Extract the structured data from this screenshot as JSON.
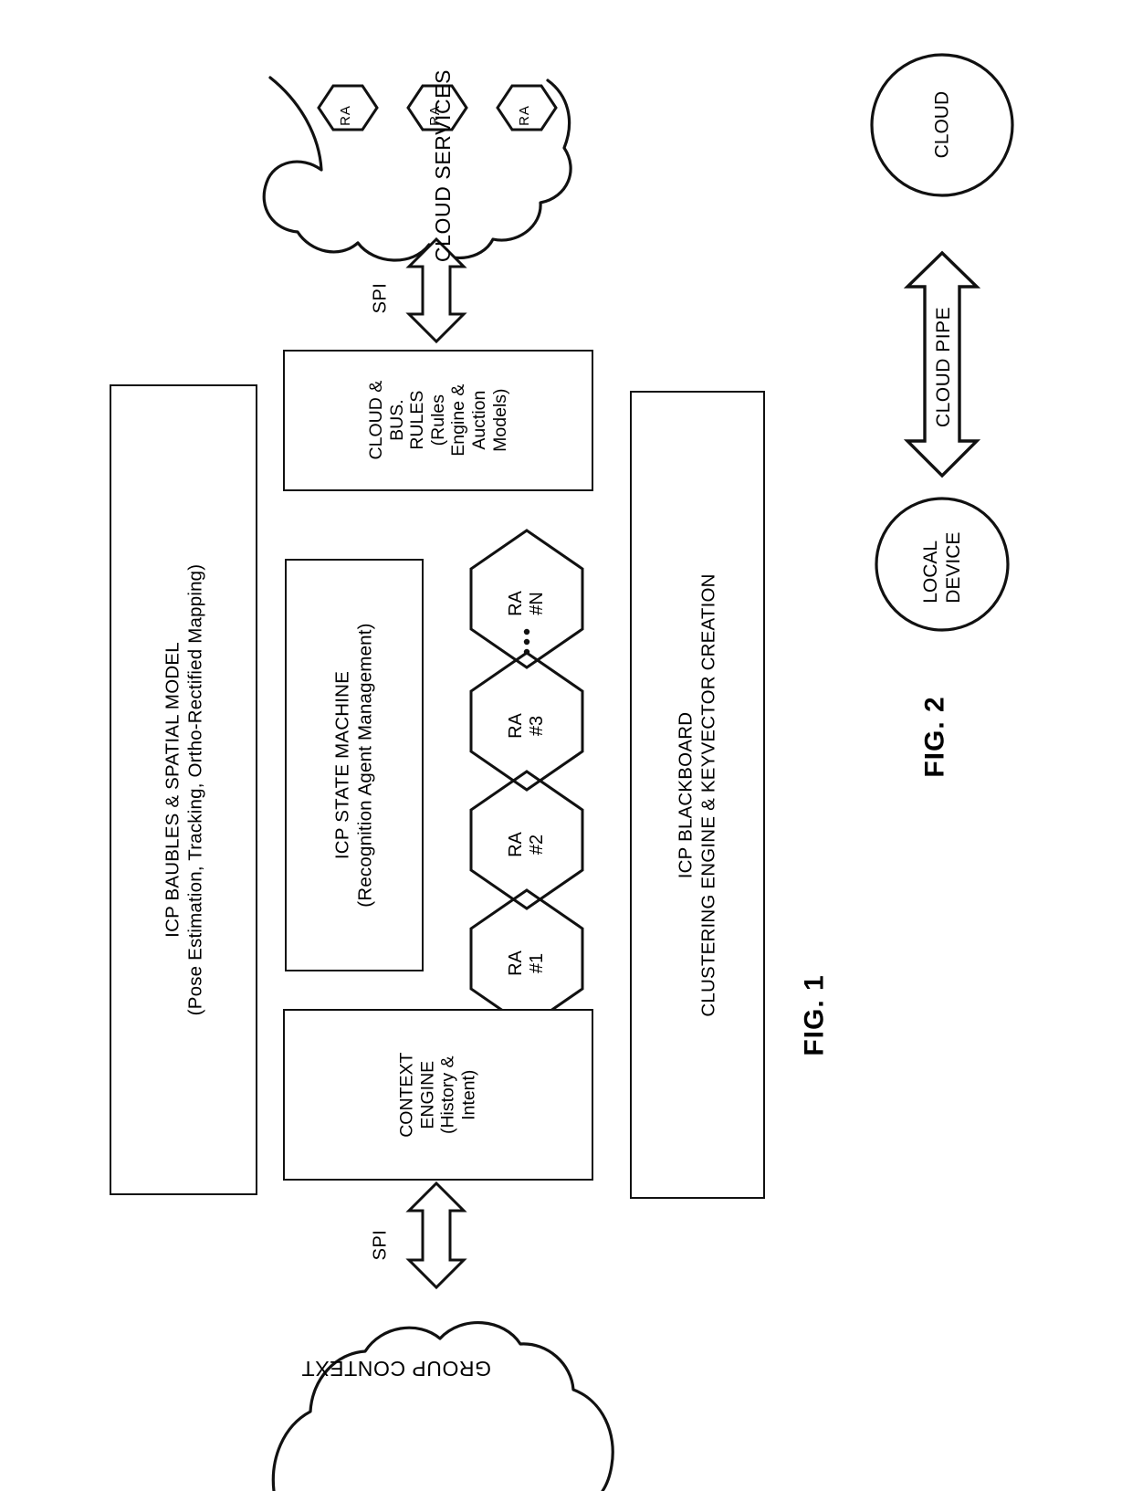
{
  "figures": {
    "fig1": {
      "label": "FIG. 1",
      "cloud_services": {
        "title": "CLOUD SERVICES",
        "agents": [
          "RA",
          "RA",
          "RA"
        ]
      },
      "spi_top": "SPI",
      "spi_bottom": "SPI",
      "group_context": "GROUP CONTEXT",
      "boxes": {
        "baubles": {
          "line1": "ICP BAUBLES & SPATIAL MODEL",
          "line2": "(Pose Estimation, Tracking, Ortho-Rectified Mapping)"
        },
        "cloud_bus_rules": {
          "lines": [
            "CLOUD &",
            "BUS.",
            "RULES",
            "(Rules",
            "Engine &",
            "Auction",
            "Models)"
          ]
        },
        "state_machine": {
          "line1": "ICP STATE MACHINE",
          "line2": "(Recognition Agent Management)"
        },
        "blackboard": {
          "line1": "ICP BLACKBOARD",
          "line2": "CLUSTERING ENGINE & KEYVECTOR CREATION"
        },
        "context_engine": {
          "lines": [
            "CONTEXT",
            "ENGINE",
            "(History &",
            "Intent)"
          ]
        }
      },
      "recognition_agents": [
        {
          "name": "RA",
          "id": "#1"
        },
        {
          "name": "RA",
          "id": "#2"
        },
        {
          "name": "RA",
          "id": "#3"
        },
        {
          "name": "RA",
          "id": "#N"
        }
      ],
      "ellipsis": "⋮"
    },
    "fig2": {
      "label": "FIG. 2",
      "cloud": "CLOUD",
      "pipe": "CLOUD PIPE",
      "local_device": {
        "line1": "LOCAL",
        "line2": "DEVICE"
      }
    }
  },
  "colors": {
    "stroke": "#111111",
    "background": "#ffffff"
  }
}
